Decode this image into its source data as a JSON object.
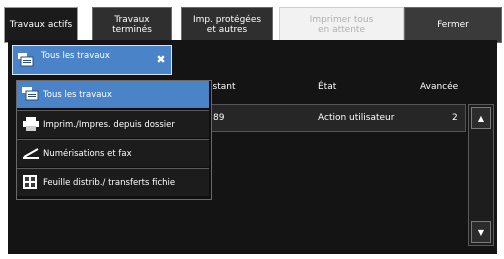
{
  "tabs": [
    {
      "label": "Travaux actifs"
    },
    {
      "label": "Travaux\nterminés"
    },
    {
      "label": "Imp. protégées\net autres"
    },
    {
      "label": "Imprimer tous\nen attente"
    },
    {
      "label": "Fermer"
    }
  ],
  "filter": {
    "selected_label": "Tous les travaux",
    "options": [
      {
        "label": "Tous les travaux",
        "icon": "all-jobs-icon"
      },
      {
        "label": "Imprim./Impres. depuis dossier",
        "icon": "printer-icon"
      },
      {
        "label": "Numérisations et fax",
        "icon": "scan-fax-icon"
      },
      {
        "label": "Feuille distrib./ transferts fichie",
        "icon": "file-transfer-icon"
      }
    ]
  },
  "table": {
    "columns": {
      "owner": "istant",
      "status": "État",
      "progress": "Avancée"
    },
    "rows": [
      {
        "owner": "89",
        "status": "Action utilisateur",
        "progress": "2"
      }
    ]
  },
  "colors": {
    "accent": "#4a83c8",
    "panel": "#141414"
  }
}
